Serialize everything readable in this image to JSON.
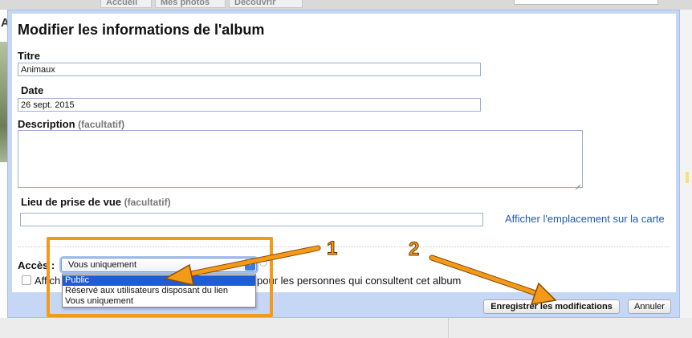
{
  "background": {
    "tabs": [
      "Accueil",
      "Mes photos",
      "Découvrir"
    ],
    "side_letter": "A"
  },
  "dialog": {
    "title": "Modifier les informations de l'album",
    "title_field": {
      "label": "Titre",
      "value": "Animaux"
    },
    "date_field": {
      "label": "Date",
      "value": "26 sept. 2015"
    },
    "description_field": {
      "label": "Description",
      "optional": "(facultatif)",
      "value": ""
    },
    "location_field": {
      "label": "Lieu de prise de vue",
      "optional": "(facultatif)",
      "value": ""
    },
    "map_link": "Afficher l'emplacement sur la carte",
    "access": {
      "label": "Accès :",
      "selected": "Vous uniquement",
      "options": [
        "Public",
        "Réservé aux utilisateurs disposant du lien",
        "Vous uniquement"
      ],
      "highlighted_option": "Public"
    },
    "show_location_checkbox": {
      "label_start": "Affich",
      "label_end": "pour les personnes qui consultent cet album",
      "checked": false
    },
    "save_button": "Enregistrer les modifications",
    "cancel_button": "Annuler"
  },
  "annotations": {
    "step1": "1",
    "step2": "2",
    "color": "#f49a1a"
  }
}
